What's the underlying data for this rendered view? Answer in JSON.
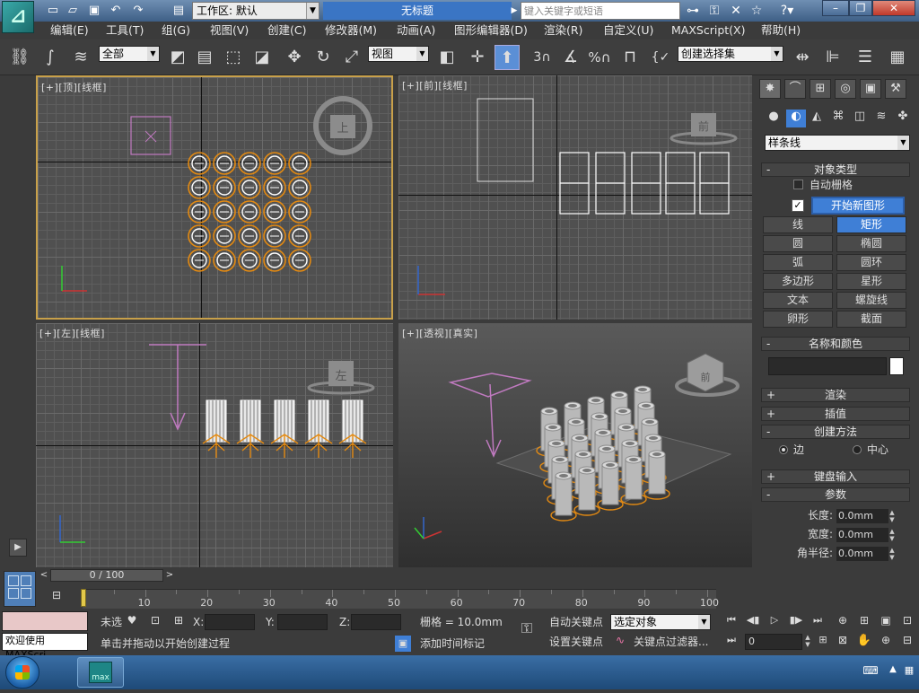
{
  "titlebar": {
    "workspace_label": "工作区: 默认",
    "doc_title": "无标题",
    "search_placeholder": "键入关键字或短语"
  },
  "menu": [
    "编辑(E)",
    "工具(T)",
    "组(G)",
    "视图(V)",
    "创建(C)",
    "修改器(M)",
    "动画(A)",
    "图形编辑器(D)",
    "渲染(R)",
    "自定义(U)",
    "MAXScript(X)",
    "帮助(H)"
  ],
  "toolbar": {
    "selection_filter": "全部",
    "ref_coord": "视图",
    "named_selection": "创建选择集",
    "snap3": "3",
    "pct": "%"
  },
  "viewports": {
    "top": {
      "label": "[+][顶][线框]"
    },
    "front": {
      "label": "[+][前][线框]"
    },
    "left": {
      "label": "[+][左][线框]"
    },
    "persp": {
      "label": "[+][透视][真实]"
    }
  },
  "cube": {
    "top": "上",
    "front": "前",
    "left": "左",
    "persp_front": "前"
  },
  "command_panel": {
    "category": "样条线",
    "rollout_object_type": "对象类型",
    "auto_grid": "自动栅格",
    "start_new_shape": "开始新图形",
    "buttons": [
      "线",
      "矩形",
      "圆",
      "椭圆",
      "弧",
      "圆环",
      "多边形",
      "星形",
      "文本",
      "螺旋线",
      "卵形",
      "截面"
    ],
    "rollout_name_color": "名称和颜色",
    "name_value": "",
    "rollout_render": "渲染",
    "rollout_interp": "插值",
    "rollout_method": "创建方法",
    "method_edge": "边",
    "method_center": "中心",
    "rollout_keyboard": "键盘输入",
    "rollout_params": "参数",
    "param_length_label": "长度:",
    "param_length": "0.0mm",
    "param_width_label": "宽度:",
    "param_width": "0.0mm",
    "param_radius_label": "角半径:",
    "param_radius": "0.0mm"
  },
  "timeline": {
    "slider_text": "0 / 100",
    "ticks": [
      "10",
      "20",
      "30",
      "40",
      "50",
      "60",
      "70",
      "80",
      "90",
      "100"
    ]
  },
  "status": {
    "maxscript_text": "欢迎使用 MAXScri",
    "none_selected": "未选",
    "x_label": "X:",
    "y_label": "Y:",
    "z_label": "Z:",
    "grid": "栅格 = 10.0mm",
    "prompt": "单击并拖动以开始创建过程",
    "add_time_tag": "添加时间标记",
    "auto_key": "自动关键点",
    "set_key": "设置关键点",
    "selected_object": "选定对象",
    "key_filter": "关键点过滤器...",
    "frame": "0"
  }
}
